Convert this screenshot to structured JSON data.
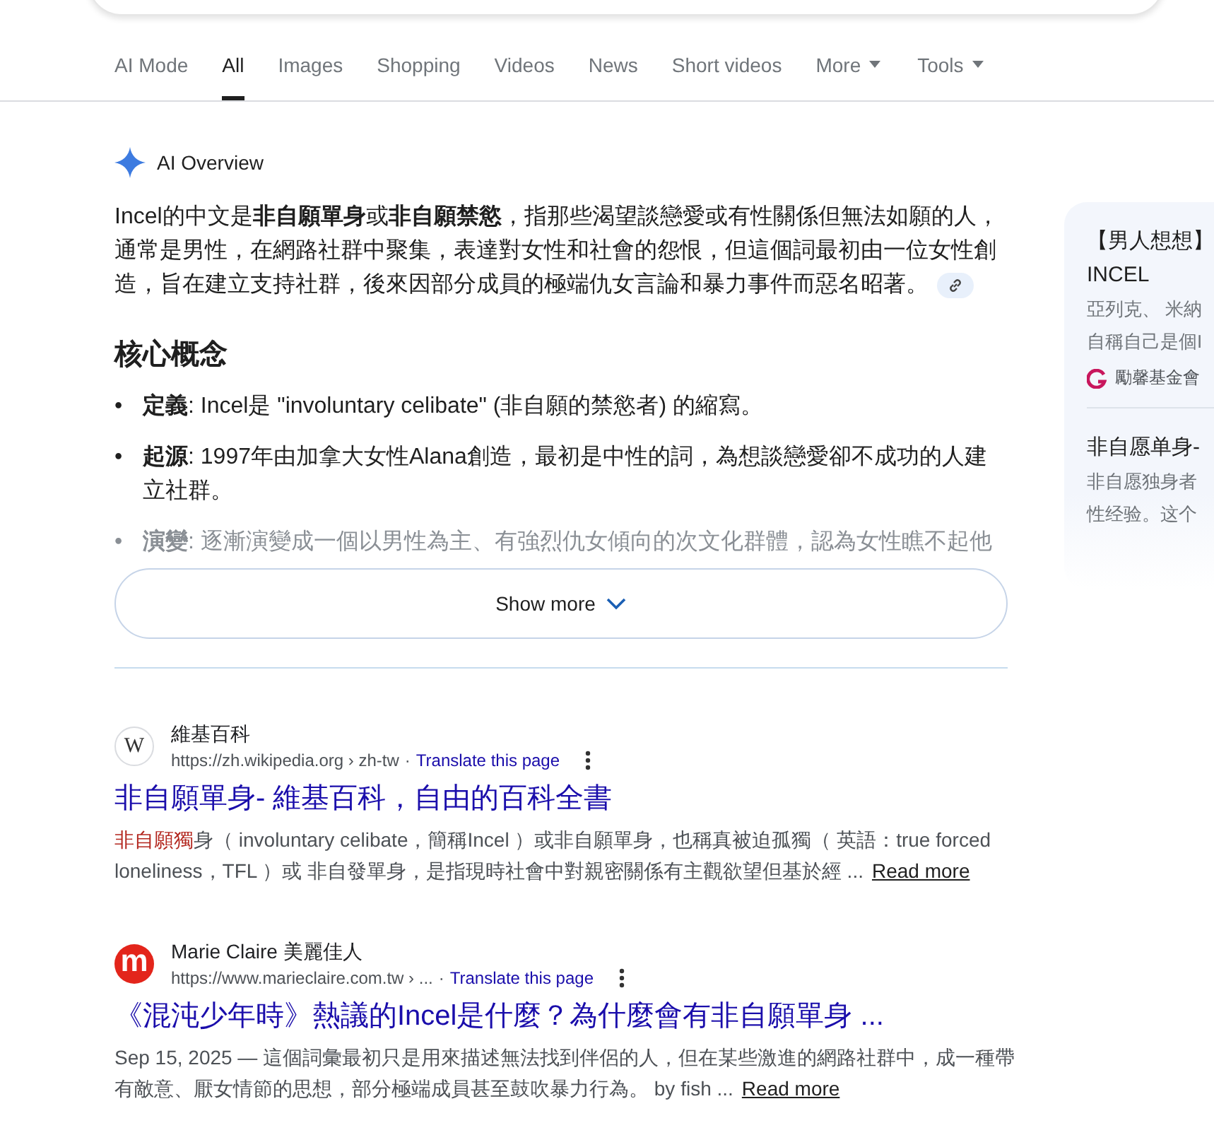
{
  "tabs": [
    {
      "label": "AI Mode",
      "selected": false,
      "dropdown": false
    },
    {
      "label": "All",
      "selected": true,
      "dropdown": false
    },
    {
      "label": "Images",
      "selected": false,
      "dropdown": false
    },
    {
      "label": "Shopping",
      "selected": false,
      "dropdown": false
    },
    {
      "label": "Videos",
      "selected": false,
      "dropdown": false
    },
    {
      "label": "News",
      "selected": false,
      "dropdown": false
    },
    {
      "label": "Short videos",
      "selected": false,
      "dropdown": false
    },
    {
      "label": "More",
      "selected": false,
      "dropdown": true
    },
    {
      "label": "Tools",
      "selected": false,
      "dropdown": true
    }
  ],
  "ai_overview": {
    "title": "AI Overview",
    "summary": "Incel的中文是**非自願單身**或**非自願禁慾**，指那些渴望談戀愛或有性關係但無法如願的人，通常是男性，在網路社群中聚集，表達對女性和社會的怨恨，但這個詞最初由一位女性創造，旨在建立支持社群，後來因部分成員的極端仇女言論和暴力事件而惡名昭著。",
    "heading": "核心概念",
    "bullets": [
      {
        "marker": "•",
        "term": "定義",
        "text": ": Incel是 \"involuntary celibate\" (非自願的禁慾者) 的縮寫。",
        "faded": false
      },
      {
        "marker": "•",
        "term": "起源",
        "text": ": 1997年由加拿大女性Alana創造，最初是中性的詞，為想談戀愛卻不成功的人建立社群。",
        "faded": false
      },
      {
        "marker": "•",
        "term": "演變",
        "text": ": 逐漸演變成一個以男性為主、有強烈仇女傾向的次文化群體，認為女性瞧不起他",
        "faded": true
      }
    ],
    "show_more": "Show more"
  },
  "side_cards": [
    {
      "title": "【男人想想】",
      "subtitle": "INCEL",
      "snippet": [
        "亞列克、 米納",
        "自稱自己是個I"
      ],
      "source": "勵馨基金會"
    },
    {
      "title": "非自愿单身-",
      "snippet": [
        "非自愿独身者",
        "性经验。这个"
      ]
    }
  ],
  "results": [
    {
      "kind": "letter",
      "favicon": "W",
      "site": "維基百科",
      "url": "https://zh.wikipedia.org › zh-tw",
      "separator": "·",
      "translate": "Translate this page",
      "title": "非自願單身- 維基百科，自由的百科全書",
      "highlight": "非自願獨",
      "snippet": "身（ involuntary celibate，簡稱Incel ）或非自願單身，也稱真被迫孤獨（ 英語：true forced loneliness，TFL ）或 非自發單身，是指現時社會中對親密關係有主觀欲望但基於經 ...",
      "read_more": "Read more"
    },
    {
      "kind": "logo",
      "favicon": "m",
      "site": "Marie Claire 美麗佳人",
      "url": "https://www.marieclaire.com.tw › ...",
      "separator": "·",
      "translate": "Translate this page",
      "title": "《混沌少年時》熱議的Incel是什麼？為什麼會有非自願單身 ...",
      "snippet": "Sep 15, 2025 — 這個詞彙最初只是用來描述無法找到伴侶的人，但在某些激進的網路社群中，成一種帶有敵意、厭女情節的思想，部分極端成員甚至鼓吹暴力行為。 by fish ...",
      "read_more": "Read more"
    }
  ]
}
